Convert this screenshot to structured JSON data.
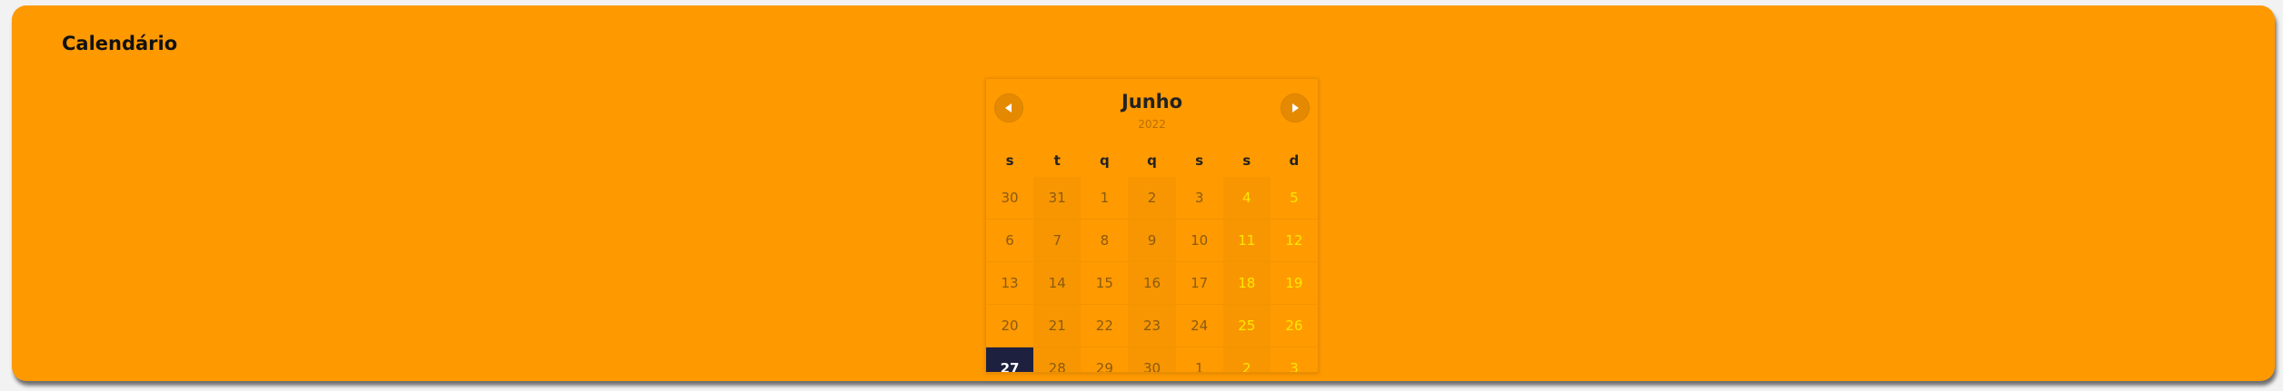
{
  "panel": {
    "title": "Calendário"
  },
  "calendar": {
    "month": "Junho",
    "year": "2022",
    "weekdays": [
      "s",
      "t",
      "q",
      "q",
      "s",
      "s",
      "d"
    ],
    "weeks": [
      [
        "30",
        "31",
        "1",
        "2",
        "3",
        "4",
        "5"
      ],
      [
        "6",
        "7",
        "8",
        "9",
        "10",
        "11",
        "12"
      ],
      [
        "13",
        "14",
        "15",
        "16",
        "17",
        "18",
        "19"
      ],
      [
        "20",
        "21",
        "22",
        "23",
        "24",
        "25",
        "26"
      ],
      [
        "27",
        "28",
        "29",
        "30",
        "1",
        "2",
        "3"
      ]
    ],
    "selected": "27",
    "prev_icon": "triangle-left-icon",
    "next_icon": "triangle-right-icon"
  },
  "colors": {
    "panel_bg": "#ff9900",
    "weekend_text": "#ffe800",
    "selected_bg": "#1e2040"
  }
}
